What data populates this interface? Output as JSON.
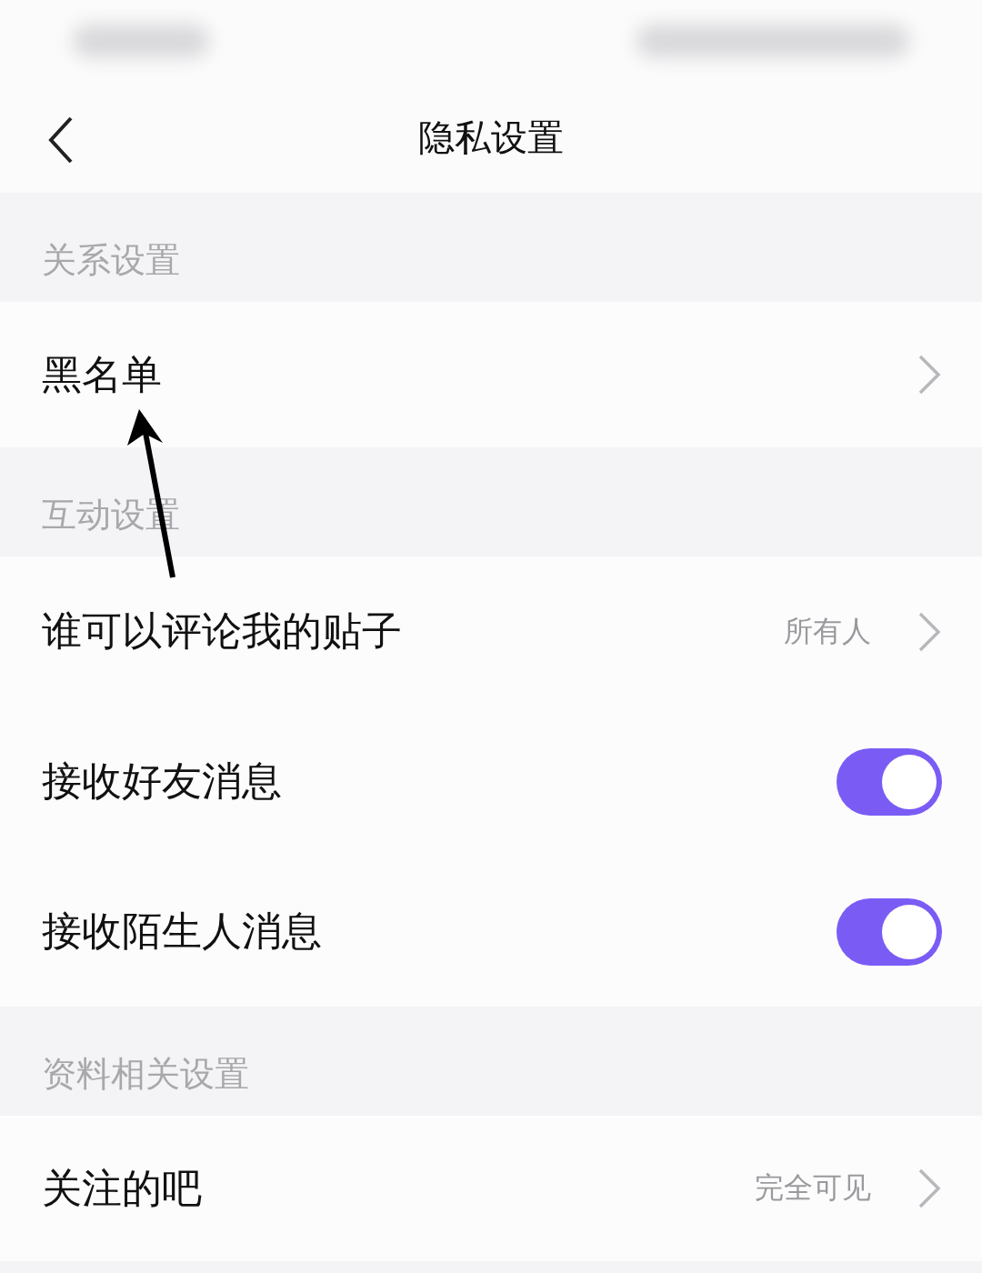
{
  "header": {
    "title": "隐私设置"
  },
  "sections": [
    {
      "title": "关系设置",
      "rows": [
        {
          "kind": "link",
          "label": "黑名单"
        }
      ]
    },
    {
      "title": "互动设置",
      "rows": [
        {
          "kind": "link",
          "label": "谁可以评论我的贴子",
          "value": "所有人"
        },
        {
          "kind": "toggle",
          "label": "接收好友消息",
          "on": true
        },
        {
          "kind": "toggle",
          "label": "接收陌生人消息",
          "on": true
        }
      ]
    },
    {
      "title": "资料相关设置",
      "rows": [
        {
          "kind": "link",
          "label": "关注的吧",
          "value": "完全可见"
        }
      ]
    }
  ]
}
